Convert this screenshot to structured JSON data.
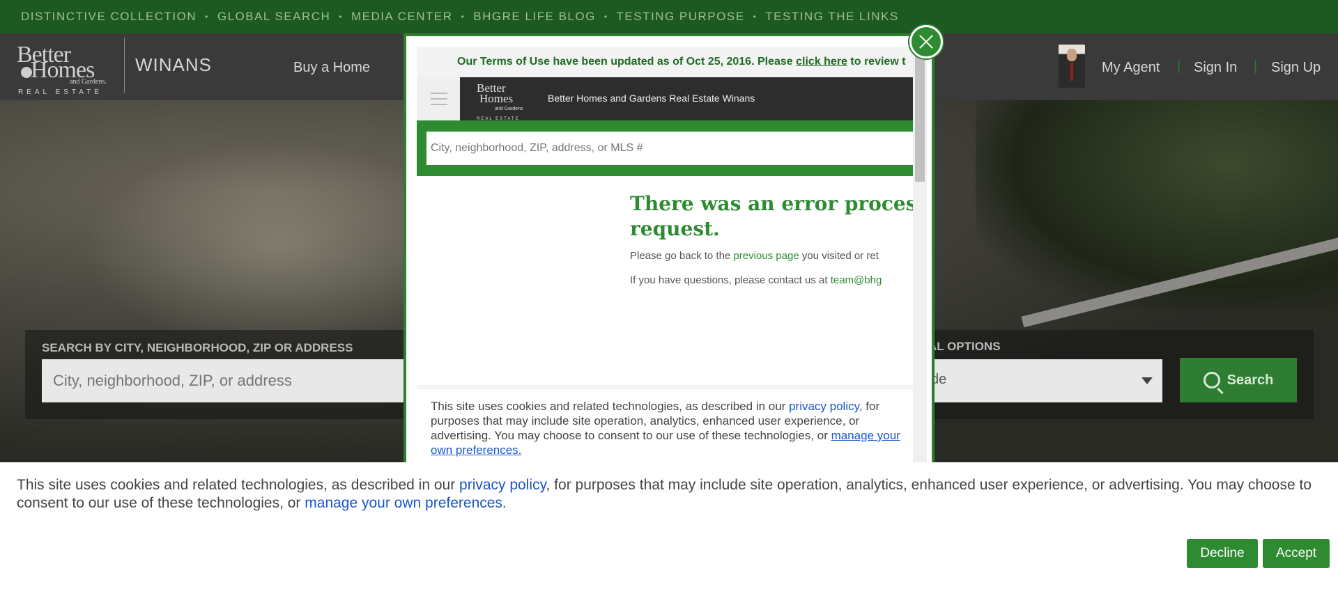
{
  "topbar": {
    "items": [
      "DISTINCTIVE COLLECTION",
      "GLOBAL SEARCH",
      "MEDIA CENTER",
      "BHGRE LIFE BLOG",
      "TESTING PURPOSE",
      "TESTING THE LINKS"
    ],
    "separator": "•"
  },
  "header": {
    "logo": {
      "line1": "Better",
      "line2": "Homes",
      "line3": "and Gardens.",
      "line4": "REAL ESTATE"
    },
    "brand": "WINANS",
    "nav_buy": "Buy a Home",
    "my_agent": "My Agent",
    "sign_in": "Sign In",
    "sign_up": "Sign Up",
    "pipe": "|"
  },
  "hero": {
    "search_label": "SEARCH BY CITY, NEIGHBORHOOD, ZIP OR ADDRESS",
    "search_placeholder": "City, neighborhood, ZIP, or address",
    "options_label": "AL OPTIONS",
    "options_value": "de",
    "search_button": "Search"
  },
  "modal": {
    "terms_text": "Our Terms of Use have been updated as of Oct 25, 2016. Please ",
    "terms_link": "click here",
    "terms_after": " to review t",
    "logo_line1": "Better",
    "logo_line2": "Homes",
    "logo_line3": "and Gardens",
    "logo_line4": "REAL ESTATE",
    "header_title": "Better Homes and Gardens Real Estate Winans",
    "search_placeholder": "City, neighborhood, ZIP, address, or MLS #",
    "error_title": "There was an error proces request.",
    "line1_pre": "Please go back to the ",
    "line1_link": "previous page",
    "line1_post": " you visited or ret",
    "line2_pre": "If you have questions, please contact us at ",
    "line2_link": "team@bhg",
    "cookie_pre": "This site uses cookies and related technologies, as described in our ",
    "cookie_link1": "privacy policy",
    "cookie_mid": ", for purposes that may include site operation, analytics, enhanced user experience, or advertising. You may choose to consent to our use of these technologies, or ",
    "cookie_link2": "manage your own preferences."
  },
  "cookie": {
    "text_pre": "This site uses cookies and related technologies, as described in our ",
    "link1": "privacy policy",
    "text_mid": ", for purposes that may include site operation, analytics, enhanced user experience, or advertising. You may choose to consent to our use of these technologies, or ",
    "link2": "manage your own preferences.",
    "decline": "Decline",
    "accept": "Accept"
  },
  "colors": {
    "brand_green": "#2e7d32",
    "link_blue": "#1a56c8",
    "topbar_green": "#1c5a22"
  }
}
